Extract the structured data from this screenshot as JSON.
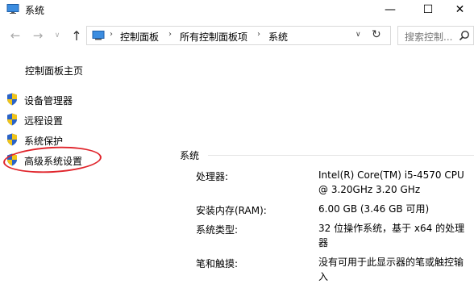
{
  "window": {
    "title": "系统",
    "minimize": "—",
    "maximize": "☐",
    "close": "✕"
  },
  "nav": {
    "back": "←",
    "forward": "→",
    "recent": "∨",
    "up": "↑",
    "breadcrumbs": [
      "控制面板",
      "所有控制面板项",
      "系统"
    ],
    "dropdown": "∨",
    "refresh": "↻",
    "search_placeholder": "搜索控制..."
  },
  "sidebar": {
    "home": "控制面板主页",
    "items": [
      {
        "label": "设备管理器"
      },
      {
        "label": "远程设置"
      },
      {
        "label": "系统保护"
      },
      {
        "label": "高级系统设置"
      }
    ]
  },
  "system": {
    "section_title": "系统",
    "rows": [
      {
        "label": "处理器:",
        "value": "Intel(R) Core(TM) i5-4570 CPU @ 3.20GHz   3.20 GHz"
      },
      {
        "label": "安装内存(RAM):",
        "value": "6.00 GB (3.46 GB 可用)"
      },
      {
        "label": "系统类型:",
        "value": "32 位操作系统，基于 x64 的处理器"
      },
      {
        "label": "笔和触摸:",
        "value": "没有可用于此显示器的笔或触控输入"
      }
    ]
  },
  "colors": {
    "highlight": "#e0242b",
    "shield_blue": "#2a63c7",
    "shield_yellow": "#f0c419"
  }
}
